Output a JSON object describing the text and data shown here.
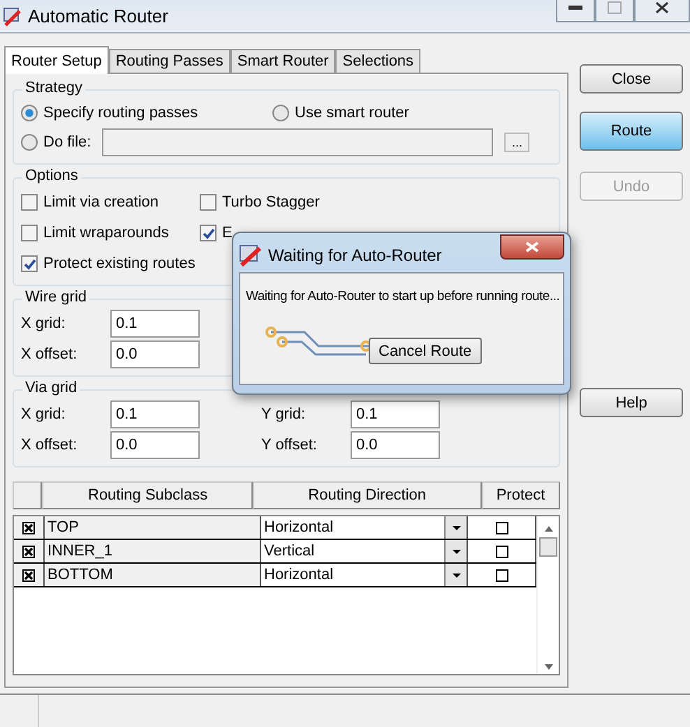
{
  "window": {
    "title": "Automatic Router"
  },
  "tabs": [
    {
      "label": "Router Setup",
      "selected": true
    },
    {
      "label": "Routing Passes",
      "selected": false
    },
    {
      "label": "Smart Router",
      "selected": false
    },
    {
      "label": "Selections",
      "selected": false
    }
  ],
  "strategy": {
    "title": "Strategy",
    "options": [
      {
        "label": "Specify routing passes",
        "selected": true
      },
      {
        "label": "Use smart router",
        "selected": false
      },
      {
        "label": "Do file:",
        "selected": false
      }
    ],
    "browse": "..."
  },
  "options": {
    "title": "Options",
    "items": [
      {
        "label": "Limit via creation",
        "checked": false
      },
      {
        "label": "Turbo Stagger",
        "checked": false
      },
      {
        "label": "Limit wraparounds",
        "checked": false
      },
      {
        "label": "E",
        "checked": true
      },
      {
        "label": "Protect existing routes",
        "checked": true
      }
    ]
  },
  "wire_grid": {
    "title": "Wire grid",
    "fields": [
      {
        "label": "X grid:",
        "value": "0.1"
      },
      {
        "label": "X offset:",
        "value": "0.0"
      }
    ]
  },
  "via_grid": {
    "title": "Via grid",
    "fields": [
      {
        "label": "X grid:",
        "value": "0.1"
      },
      {
        "label": "Y grid:",
        "value": "0.1"
      },
      {
        "label": "X offset:",
        "value": "0.0"
      },
      {
        "label": "Y offset:",
        "value": "0.0"
      }
    ]
  },
  "table": {
    "columns": [
      "Routing Subclass",
      "Routing Direction",
      "Protect"
    ],
    "rows": [
      {
        "included": true,
        "subclass": "TOP",
        "direction": "Horizontal",
        "protect": false
      },
      {
        "included": true,
        "subclass": "INNER_1",
        "direction": "Vertical",
        "protect": false
      },
      {
        "included": true,
        "subclass": "BOTTOM",
        "direction": "Horizontal",
        "protect": false
      }
    ]
  },
  "buttons": [
    {
      "label": "Close",
      "kind": "normal",
      "disabled": false
    },
    {
      "label": "Route",
      "kind": "default",
      "disabled": false
    },
    {
      "label": "Undo",
      "kind": "normal",
      "disabled": true
    },
    {
      "label": "Help",
      "kind": "normal",
      "disabled": false
    }
  ],
  "dialog": {
    "title": "Waiting for Auto-Router",
    "message": "Waiting for Auto-Router to start up before running route...",
    "button": "Cancel Route"
  }
}
